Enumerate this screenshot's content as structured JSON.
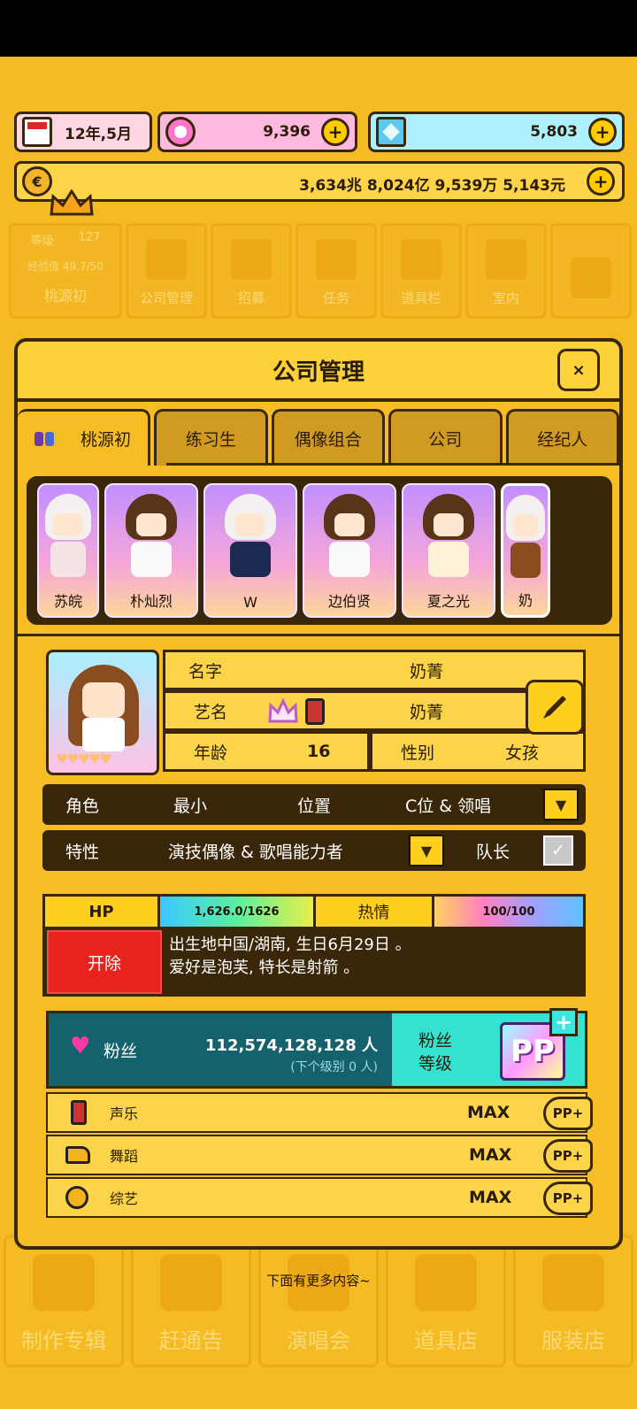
{
  "top": {
    "date": "12年,5月",
    "gems": "9,396",
    "diamonds": "5,803",
    "money": "3,634兆 8,024亿 9,539万 5,143元"
  },
  "bg_nav": {
    "level_label": "等级",
    "level_value": "127",
    "exp": "经验值 49.7/50",
    "company": "桃源初",
    "items": [
      "公司管理",
      "招募",
      "任务",
      "道具栏",
      "室内"
    ]
  },
  "bg_bottom": [
    "制作专辑",
    "赶通告",
    "演唱会",
    "道具店",
    "服装店"
  ],
  "panel": {
    "title": "公司管理",
    "close": "×",
    "tabs": [
      "桃源初",
      "练习生",
      "偶像组合",
      "公司",
      "经纪人"
    ]
  },
  "characters": [
    "苏皖",
    "朴灿烈",
    "W",
    "边伯贤",
    "夏之光",
    "奶"
  ],
  "profile": {
    "name_label": "名字",
    "name_value": "奶菁",
    "stage_label": "艺名",
    "stage_value": "奶菁",
    "age_label": "年龄",
    "age_value": "16",
    "gender_label": "性别",
    "gender_value": "女孩"
  },
  "role": {
    "role_label": "角色",
    "role_value": "最小",
    "position_label": "位置",
    "position_value": "C位 & 领唱"
  },
  "trait": {
    "label": "特性",
    "value": "演技偶像 & 歌唱能力者",
    "leader_label": "队长"
  },
  "stats": {
    "hp_label": "HP",
    "hp_value": "1,626.0/1626",
    "passion_label": "热情",
    "passion_value": "100/100",
    "fire_label": "开除",
    "desc_line1": "出生地中国/湖南, 生日6月29日 。",
    "desc_line2": "爱好是泡芙, 特长是射箭 。"
  },
  "fans": {
    "label": "粉丝",
    "count": "112,574,128,128 人",
    "next": "(下个级别 0 人)",
    "level_label_1": "粉丝",
    "level_label_2": "等级",
    "level_badge": "PP"
  },
  "skills": [
    {
      "name": "声乐",
      "value": "MAX",
      "btn": "PP+"
    },
    {
      "name": "舞蹈",
      "value": "MAX",
      "btn": "PP+"
    },
    {
      "name": "综艺",
      "value": "MAX",
      "btn": "PP+"
    }
  ],
  "more_hint": "下面有更多内容~",
  "colors": {
    "background": "#f5bb22",
    "dark": "#3a2608",
    "fire": "#e8231e",
    "fans_dark": "#13626d",
    "fans_light": "#35e2d2"
  }
}
